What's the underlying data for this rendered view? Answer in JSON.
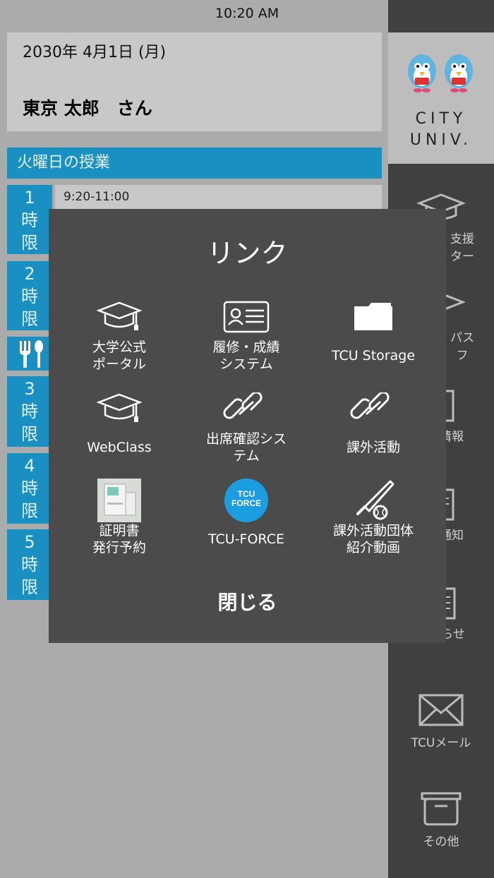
{
  "status_bar": {
    "time": "10:20 AM"
  },
  "header": {
    "date": "2030年 4月1日 (月)",
    "user_name": "東京 太郎　さん"
  },
  "schedule": {
    "day_title": "火曜日の授業",
    "first_time": "9:20-11:00",
    "periods": [
      {
        "n": "1",
        "a": "時",
        "b": "限"
      },
      {
        "n": "2",
        "a": "時",
        "b": "限"
      },
      {
        "n": "3",
        "a": "時",
        "b": "限"
      },
      {
        "n": "4",
        "a": "時",
        "b": "限"
      },
      {
        "n": "5",
        "a": "時",
        "b": "限"
      }
    ]
  },
  "sidebar": {
    "logo_line1": "CITY",
    "logo_line2": "UNIV.",
    "items": [
      {
        "label": "支援\nター",
        "icon": "graduation-cap-icon"
      },
      {
        "label": "パス\nフ",
        "icon": "campus-icon"
      },
      {
        "label": "情報",
        "icon": "document-icon"
      },
      {
        "label": "通知",
        "icon": "notice-icon"
      },
      {
        "label": "お知らせ",
        "icon": "news-icon"
      },
      {
        "label": "TCUメール",
        "icon": "mail-icon"
      },
      {
        "label": "その他",
        "icon": "box-icon"
      }
    ]
  },
  "modal": {
    "title": "リンク",
    "links": [
      {
        "label": "大学公式\nポータル",
        "icon": "graduation-cap-icon"
      },
      {
        "label": "履修・成績\nシステム",
        "icon": "id-card-icon"
      },
      {
        "label": "TCU Storage",
        "icon": "folder-icon"
      },
      {
        "label": "WebClass",
        "icon": "graduation-cap-icon"
      },
      {
        "label": "出席確認シス\nテム",
        "icon": "link-icon"
      },
      {
        "label": "課外活動",
        "icon": "link-icon"
      },
      {
        "label": "証明書\n発行予約",
        "icon": "kiosk-image"
      },
      {
        "label": "TCU-FORCE",
        "icon": "tcu-force-logo"
      },
      {
        "label": "課外活動団体\n紹介動画",
        "icon": "baseball-icon"
      }
    ],
    "tcu_force_logo_text": "TCU FORCE",
    "close_label": "閉じる"
  },
  "colors": {
    "accent": "#1a8fc1",
    "modal_bg": "#4b4b4b",
    "sidebar_bg": "#404040"
  }
}
